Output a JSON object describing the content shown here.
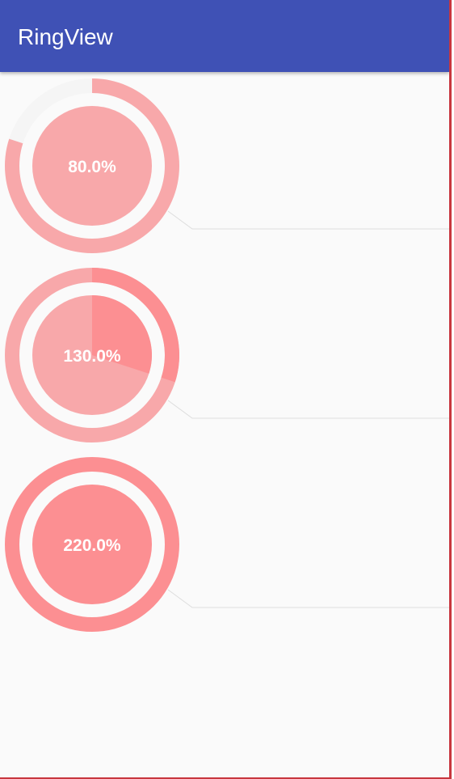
{
  "app": {
    "title": "RingView"
  },
  "rings": [
    {
      "label": "80.0%",
      "progress": 0.8
    },
    {
      "label": "130.0%",
      "progress": 1.3
    },
    {
      "label": "220.0%",
      "progress": 2.2
    }
  ],
  "colors": {
    "appbar": "#3f51b5",
    "background": "#fafafa",
    "ring_light": "#f8a8aa",
    "ring_strong": "#fc8f92",
    "ring_track": "#f5f5f5",
    "connector_line": "#dddddd",
    "frame_border": "#c8363e"
  }
}
